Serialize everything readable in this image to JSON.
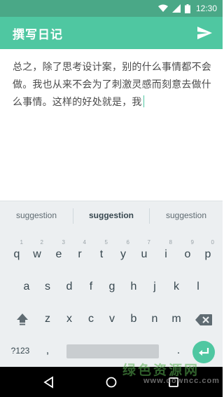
{
  "status_bar": {
    "time": "12:30",
    "icons": [
      "wifi-icon",
      "signal-icon",
      "battery-icon"
    ]
  },
  "app_bar": {
    "title": "撰写日记",
    "send_icon": "send-icon"
  },
  "editor": {
    "text": "总之，除了思考设计案，别的什么事情都不会做。我也从来不会为了刺激灵感而刻意去做什么事情。这样的好处就是，我"
  },
  "keyboard": {
    "suggestions": [
      "suggestion",
      "suggestion",
      "suggestion"
    ],
    "row1": [
      {
        "label": "q",
        "hint": "1"
      },
      {
        "label": "w",
        "hint": "2"
      },
      {
        "label": "e",
        "hint": "3"
      },
      {
        "label": "r",
        "hint": "4"
      },
      {
        "label": "t",
        "hint": "5"
      },
      {
        "label": "y",
        "hint": "6"
      },
      {
        "label": "u",
        "hint": "7"
      },
      {
        "label": "i",
        "hint": "8"
      },
      {
        "label": "o",
        "hint": "9"
      },
      {
        "label": "p",
        "hint": "0"
      }
    ],
    "row2": [
      "a",
      "s",
      "d",
      "f",
      "g",
      "h",
      "j",
      "k",
      "l"
    ],
    "row3": [
      "z",
      "x",
      "c",
      "v",
      "b",
      "n",
      "m"
    ],
    "symbols_label": "?123",
    "comma": ",",
    "period": "."
  },
  "nav_bar": {
    "icons": [
      "back-icon",
      "home-icon",
      "recents-icon"
    ]
  },
  "watermark": {
    "text_cn": "绿色资源网",
    "url": "www.downcc.com"
  },
  "colors": {
    "status_bar": "#4aa887",
    "app_bar": "#4fc7a1",
    "accent": "#4fc7a1",
    "keyboard_bg": "#eceff1"
  }
}
